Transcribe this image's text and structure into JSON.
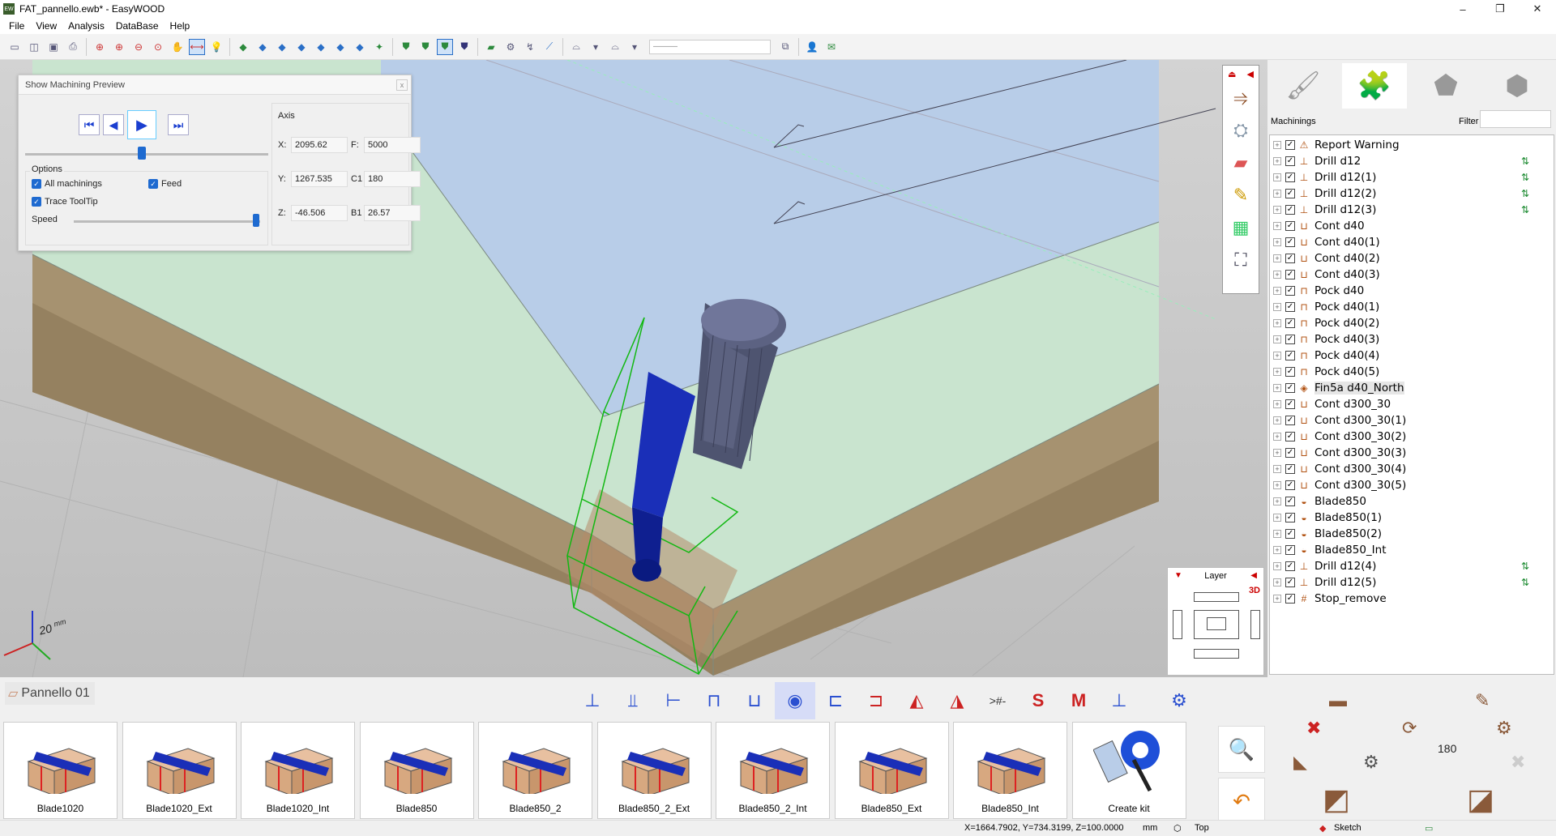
{
  "app": {
    "title": "FAT_pannello.ewb* - EasyWOOD",
    "icon_text": "EW"
  },
  "window_buttons": [
    "–",
    "❐",
    "✕"
  ],
  "menu": [
    "File",
    "View",
    "Analysis",
    "DataBase",
    "Help"
  ],
  "toolbar": {
    "layer_select_value": "———"
  },
  "preview": {
    "title": "Show Machining Preview",
    "close_label": "x",
    "options_label": "Options",
    "all_machinings": "All machinings",
    "feed": "Feed",
    "trace_tooltip": "Trace ToolTip",
    "speed": "Speed",
    "progress": 0.48,
    "speed_level": 0.98,
    "axis_label": "Axis",
    "x_label": "X:",
    "x_value": "2095.62",
    "f_label": "F:",
    "f_value": "5000",
    "y_label": "Y:",
    "y_value": "1267.535",
    "c1_label": "C1",
    "c1_value": "180",
    "z_label": "Z:",
    "z_value": "-46.506",
    "b1_label": "B1",
    "b1_value": "26.57"
  },
  "viewport": {
    "scale_value": "20",
    "scale_unit": "mm"
  },
  "layer_widget": {
    "title": "Layer",
    "mode": "3D"
  },
  "right_panel": {
    "machinings_label": "Machinings",
    "filter_label": "Filter",
    "filter_value": "",
    "items": [
      {
        "name": "Report Warning",
        "warn": false
      },
      {
        "name": "Drill d12",
        "warn": true
      },
      {
        "name": "Drill d12(1)",
        "warn": true
      },
      {
        "name": "Drill d12(2)",
        "warn": true
      },
      {
        "name": "Drill d12(3)",
        "warn": true
      },
      {
        "name": "Cont d40",
        "warn": false
      },
      {
        "name": "Cont d40(1)",
        "warn": false
      },
      {
        "name": "Cont d40(2)",
        "warn": false
      },
      {
        "name": "Cont d40(3)",
        "warn": false
      },
      {
        "name": "Pock d40",
        "warn": false
      },
      {
        "name": "Pock d40(1)",
        "warn": false
      },
      {
        "name": "Pock d40(2)",
        "warn": false
      },
      {
        "name": "Pock d40(3)",
        "warn": false
      },
      {
        "name": "Pock d40(4)",
        "warn": false
      },
      {
        "name": "Pock d40(5)",
        "warn": false
      },
      {
        "name": "Fin5a d40_North",
        "warn": false,
        "selected": true
      },
      {
        "name": "Cont d300_30",
        "warn": false
      },
      {
        "name": "Cont d300_30(1)",
        "warn": false
      },
      {
        "name": "Cont d300_30(2)",
        "warn": false
      },
      {
        "name": "Cont d300_30(3)",
        "warn": false
      },
      {
        "name": "Cont d300_30(4)",
        "warn": false
      },
      {
        "name": "Cont d300_30(5)",
        "warn": false
      },
      {
        "name": "Blade850",
        "warn": false
      },
      {
        "name": "Blade850(1)",
        "warn": false
      },
      {
        "name": "Blade850(2)",
        "warn": false
      },
      {
        "name": "Blade850_Int",
        "warn": false
      },
      {
        "name": "Drill d12(4)",
        "warn": true
      },
      {
        "name": "Drill d12(5)",
        "warn": true
      },
      {
        "name": "Stop_remove",
        "warn": false
      }
    ]
  },
  "bottom": {
    "panel_name": "Pannello 01",
    "kits": [
      "Blade1020",
      "Blade1020_Ext",
      "Blade1020_Int",
      "Blade850",
      "Blade850_2",
      "Blade850_2_Ext",
      "Blade850_2_Int",
      "Blade850_Ext",
      "Blade850_Int",
      "Create kit"
    ],
    "rot_label": "180"
  },
  "status": {
    "coords": "X=1664.7902, Y=734.3199, Z=100.0000",
    "unit": "mm",
    "view": "Top",
    "mode": "Sketch"
  },
  "colors": {
    "accent": "#1e6ad0",
    "warn_green": "#1b8a30",
    "tool_blue": "#1a2fb8"
  }
}
